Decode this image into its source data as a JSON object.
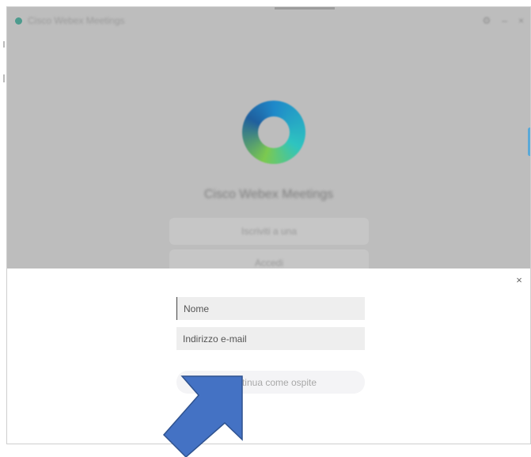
{
  "window": {
    "title": "Cisco Webex Meetings",
    "controls": [
      "⚙",
      "–",
      "×"
    ]
  },
  "background_page": {
    "product_name": "Cisco Webex Meetings",
    "buttons": [
      "Iscriviti a una",
      "Accedi"
    ]
  },
  "dialog": {
    "close_label": "×",
    "name_field": {
      "placeholder": "Nome",
      "value": ""
    },
    "email_field": {
      "placeholder": "Indirizzo e-mail",
      "value": ""
    },
    "guest_button_label": "Continua come ospite"
  },
  "annotation": {
    "arrow_color": "#4472c4",
    "arrow_border": "#2f528f"
  },
  "colors": {
    "overlay": "#bdbdbd",
    "logo_accent": "#1e88c9"
  }
}
